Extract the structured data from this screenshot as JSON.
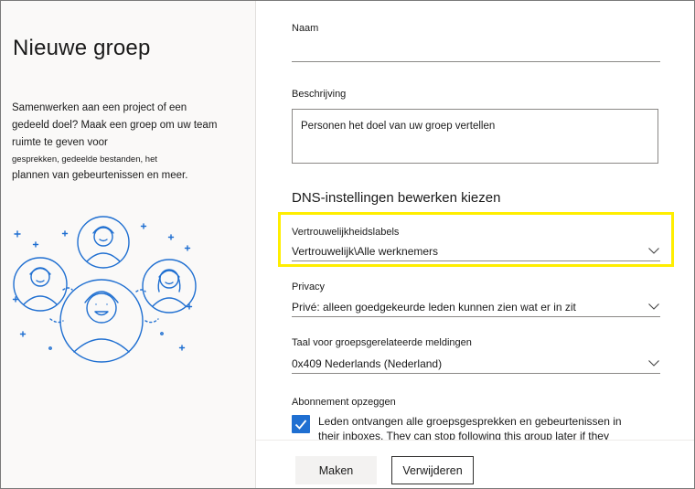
{
  "left": {
    "title": "Nieuwe groep",
    "desc_line1": "Samenwerken aan een project of een",
    "desc_line2": "gedeeld doel? Maak een groep om uw team",
    "desc_line3": "ruimte te geven voor",
    "desc_line4": "gesprekken, gedeelde bestanden, het",
    "desc_line5": "plannen van gebeurtenissen en meer."
  },
  "form": {
    "name_label": "Naam",
    "name_value": "",
    "description_label": "Beschrijving",
    "description_placeholder": "Personen het doel van uw groep vertellen",
    "section_title": "DNS-instellingen bewerken kiezen",
    "sensitivity_label": "Vertrouwelijkheidslabels",
    "sensitivity_value": "Vertrouwelijk\\Alle werknemers",
    "privacy_label": "Privacy",
    "privacy_value": "Privé: alleen goedgekeurde leden kunnen zien wat er in zit",
    "language_label": "Taal voor groepsgerelateerde meldingen",
    "language_value": "0x409 Nederlands (Nederland)",
    "subscription_label": "Abonnement opzeggen",
    "subscription_checked": true,
    "subscription_text_line1": "Leden ontvangen alle groepsgesprekken en gebeurtenissen in",
    "subscription_text_line2": "their inboxes. They can stop following this group later if they"
  },
  "footer": {
    "create_label": "Maken",
    "discard_label": "Verwijderen"
  },
  "colors": {
    "highlight": "#ffee00",
    "checkbox": "#1f6fd1",
    "illustration": "#1f6fd1"
  }
}
